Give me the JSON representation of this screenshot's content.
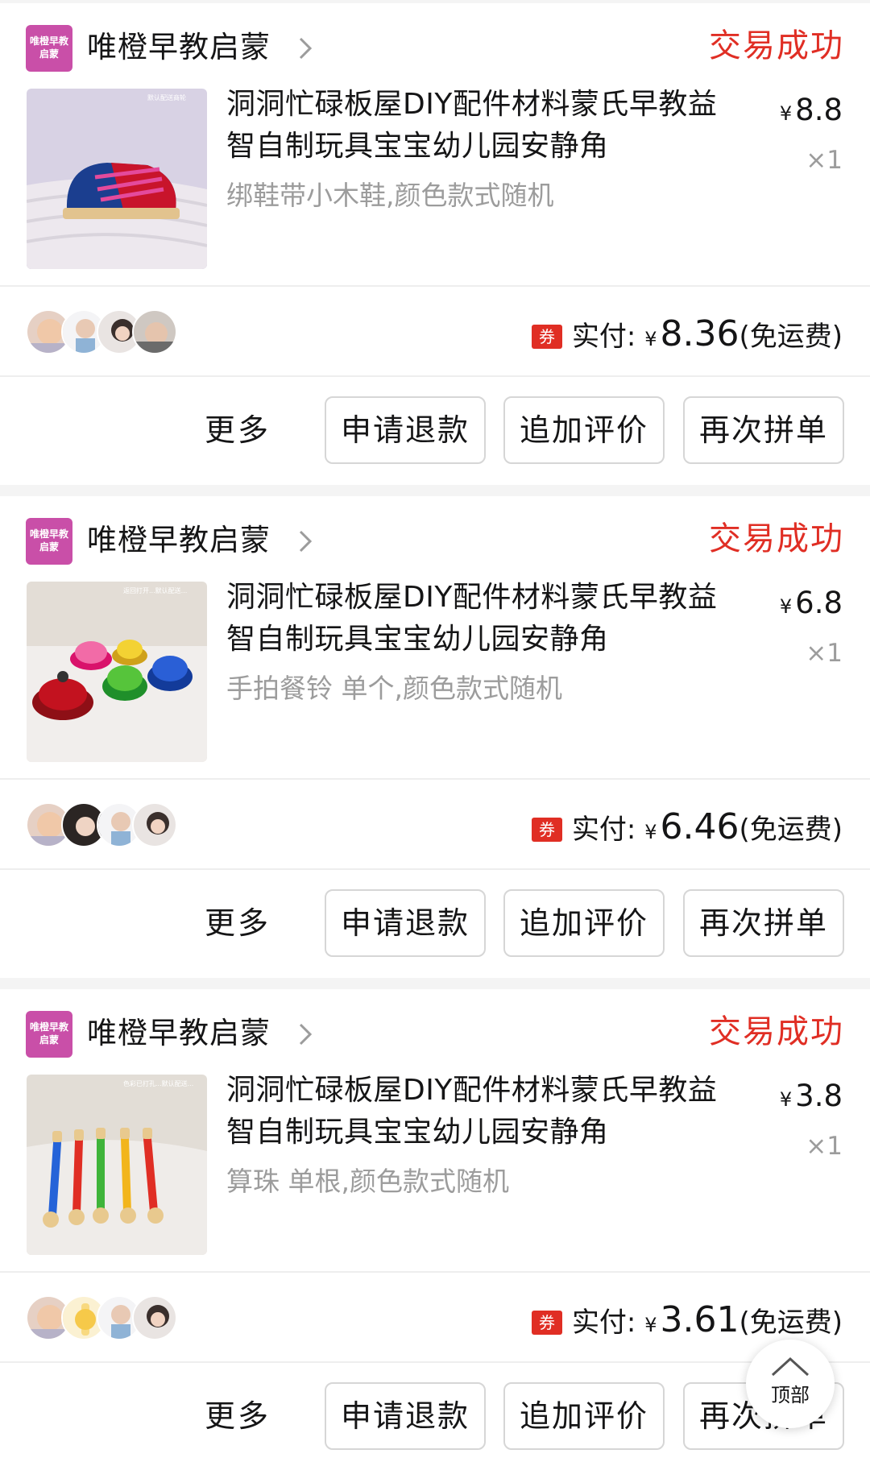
{
  "orders": [
    {
      "shop_logo_text": "唯橙早教启蒙",
      "shop_name": "唯橙早教启蒙",
      "status": "交易成功",
      "thumb_caption": "默认配送商轮",
      "title": "洞洞忙碌板屋DIY配件材料蒙氏早教益智自制玩具宝宝幼儿园安静角",
      "spec": "绑鞋带小木鞋,颜色款式随机",
      "price_symbol": "¥",
      "price": "8.8",
      "quantity": "×1",
      "coupon": "券",
      "paid_label": "实付:",
      "paid_symbol": "¥",
      "paid_amount": "8.36",
      "shipping_note": "(免运费)",
      "actions": {
        "more": "更多",
        "refund": "申请退款",
        "review": "追加评价",
        "reorder": "再次拼单"
      }
    },
    {
      "shop_logo_text": "唯橙早教启蒙",
      "shop_name": "唯橙早教启蒙",
      "status": "交易成功",
      "thumb_caption": "返回打开...默认配送...",
      "title": "洞洞忙碌板屋DIY配件材料蒙氏早教益智自制玩具宝宝幼儿园安静角",
      "spec": "手拍餐铃 单个,颜色款式随机",
      "price_symbol": "¥",
      "price": "6.8",
      "quantity": "×1",
      "coupon": "券",
      "paid_label": "实付:",
      "paid_symbol": "¥",
      "paid_amount": "6.46",
      "shipping_note": "(免运费)",
      "actions": {
        "more": "更多",
        "refund": "申请退款",
        "review": "追加评价",
        "reorder": "再次拼单"
      }
    },
    {
      "shop_logo_text": "唯橙早教启蒙",
      "shop_name": "唯橙早教启蒙",
      "status": "交易成功",
      "thumb_caption": "色彩已打孔...默认配送...",
      "title": "洞洞忙碌板屋DIY配件材料蒙氏早教益智自制玩具宝宝幼儿园安静角",
      "spec": "算珠 单根,颜色款式随机",
      "price_symbol": "¥",
      "price": "3.8",
      "quantity": "×1",
      "coupon": "券",
      "paid_label": "实付:",
      "paid_symbol": "¥",
      "paid_amount": "3.61",
      "shipping_note": "(免运费)",
      "actions": {
        "more": "更多",
        "refund": "申请退款",
        "review": "追加评价",
        "reorder": "再次拼单"
      }
    }
  ],
  "back_to_top": "顶部",
  "colors": {
    "accent": "#e02e24",
    "muted": "#9c9c9c",
    "text": "#151516",
    "shop_logo": "#c94fa8"
  }
}
